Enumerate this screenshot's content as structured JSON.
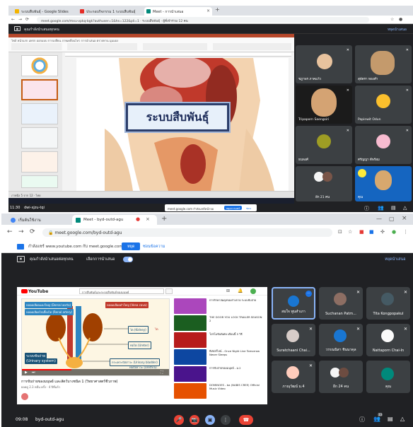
{
  "top": {
    "tabs": [
      {
        "label": "ระบบสืบพันธุ์ - Google Slides"
      },
      {
        "label": "ประกอบกิจกรรม 1 ระบบสืบพันธุ์"
      },
      {
        "label": "Meet - การนำเสนอ"
      }
    ],
    "new_tab_symbol": "+",
    "url": "meet.google.com/mxu-vpkq-bgk?authuser=1&hs=122&pli=1 · ระบบสืบพันธุ์ · ผู้ที่เข้าร่วม 12 คน",
    "meet_bar_text": "คุณกำลังนำเสนอทุกคน",
    "meet_bar_right": "หยุดนำเสนอ",
    "ribbon_tabs": "ไฟล์   หน้าแรก   แทรก   ออกแบบ   การเปลี่ยน   ภาพเคลื่อนไหว   การนำเสนอ   ตรวจทาน   มุมมอง",
    "slide_title": "ระบบสืบพันธุ์",
    "ppt_status": "ภาพนิ่ง 5 จาก 12 · ไทย",
    "time": "11:30",
    "meeting_code": "dwi-xjzu-tqi",
    "share_text": "meet.google.com กำลังแชร์หน้าจอ",
    "share_stop": "หยุดการแชร์",
    "share_hide": "ซ่อน",
    "participants": [
      {
        "name": "ชฎาพร ภาคแก้ว"
      },
      {
        "name": "สุพัตรา ทองคำ"
      },
      {
        "name": "Tripaporn Saengsiri"
      },
      {
        "name": "Papinwit Odun"
      },
      {
        "name": "ธนพงศ์"
      },
      {
        "name": "ศรัญญา ดีพร้อม"
      },
      {
        "name": "อีก 21 คน"
      },
      {
        "name": "คุณ"
      }
    ]
  },
  "bottom": {
    "tabs": [
      {
        "label": "เริ่มต้นใช้งาน"
      },
      {
        "label": "Meet - byd-outd-agu"
      }
    ],
    "new_tab_symbol": "+",
    "url": "meet.google.com/byd-outd-agu",
    "infobar_text": "กำลังแชร์ www.youtube.com กับ meet.google.com",
    "infobar_stop": "หยุด",
    "infobar_hide": "ซ่อนข้อความ",
    "meet_bar_text": "คุณกำลังนำเสนอต่อทุกคน",
    "meet_bar_toggle_label": "เลือกการนำเสนอ",
    "meet_bar_right": "หยุดนำเสนอ",
    "youtube": {
      "logo": "YouTube",
      "search": "การสืบพันธุ์และระบบสืบพันธุ์ของมนุษย์",
      "video_labels": [
        "หลอดเลือดแดงใหญ่ (Dorsal aorta)",
        "หลอดเลือดดำใหญ่ (Vena cava)",
        "หลอดเลือดไปเลี้ยงไต (Renal artery)",
        "ไต (Kidney)",
        "ท่อไต (Ureter)",
        "กระเพาะปัสสาวะ (Urinary bladder)",
        "ท่อปัสสาวะ (Urethra)",
        "ระบบขับถ่าย",
        "(Urinary system)"
      ],
      "video_label_keyword": "ไต",
      "video_title": "การขับถ่ายของมนุษย์ และสัตว์บางชนิด 1 (วิทยาศาสตร์ชีวภาพ)",
      "video_meta": "ยอดดู 2.3 หมื่น ครั้ง · 4 ปีที่แล้ว",
      "recommendations": [
        {
          "title": "การรักษาสมดุลของร่างกาย ระบบขับถ่าย"
        },
        {
          "title": "THE DOOR YOU LOCK TRAILER SEASON 2"
        },
        {
          "title": "โปรโมชันพิเศษ เดือนนี้ 5 วิธี"
        },
        {
          "title": "พีเซอร์ไลน์ - Once Night Live Tomorrow Never Sleeps"
        },
        {
          "title": "การขับถ่ายของมนุษย์ - ม.2"
        },
        {
          "title": "DOMINOES - ba (NABIS CREE) Official Music Video"
        }
      ]
    },
    "participants": [
      {
        "name": "สมใจ พูนสำเภา"
      },
      {
        "name": "Suchanan Patm..."
      },
      {
        "name": "Tita Kongpopakul"
      },
      {
        "name": "Suratchaani Chai..."
      },
      {
        "name": "วรรณนิสา ชินนาคุล"
      },
      {
        "name": "Nattaporn Chai-In"
      },
      {
        "name": "ภาณุวัฒน์ ม.4"
      },
      {
        "name": "อีก 24 คน"
      },
      {
        "name": "คุณ"
      }
    ],
    "time": "09:08",
    "meeting_code": "byd-outd-agu",
    "participant_count": "33"
  }
}
